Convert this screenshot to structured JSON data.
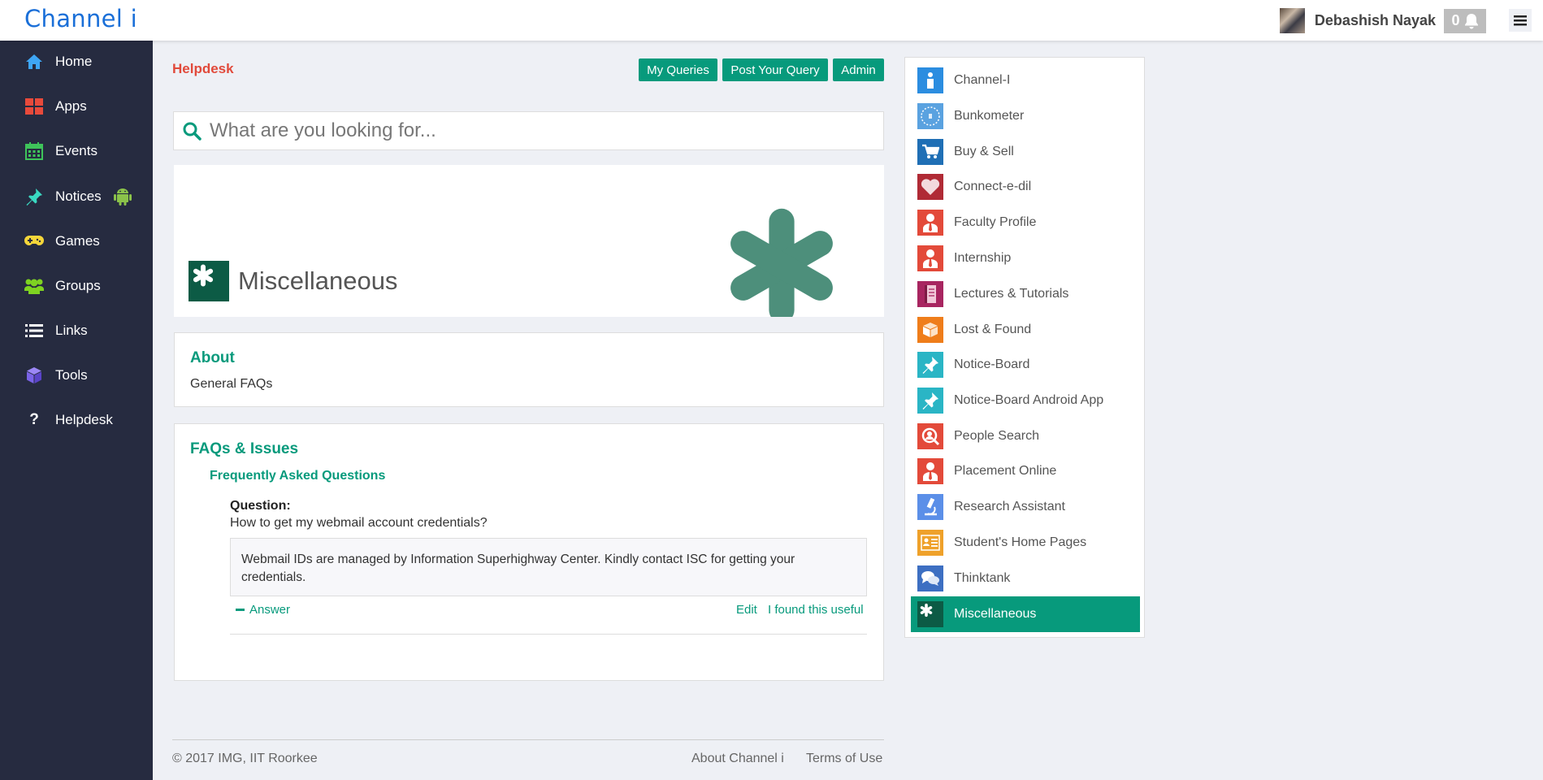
{
  "brand": "Channel i",
  "user": {
    "name": "Debashish Nayak",
    "notifications": "0"
  },
  "sidebar": {
    "items": [
      {
        "label": "Home",
        "icon": "home-icon",
        "color": "#3ea6f5"
      },
      {
        "label": "Apps",
        "icon": "apps-icon",
        "color": "#e84a3b"
      },
      {
        "label": "Events",
        "icon": "calendar-icon",
        "color": "#3ec35a"
      },
      {
        "label": "Notices",
        "icon": "pin-icon",
        "color": "#3ad9c2"
      },
      {
        "label": "Games",
        "icon": "gamepad-icon",
        "color": "#f5d63a"
      },
      {
        "label": "Groups",
        "icon": "users-icon",
        "color": "#7ed321"
      },
      {
        "label": "Links",
        "icon": "list-icon",
        "color": "#ffffff"
      },
      {
        "label": "Tools",
        "icon": "cube-icon",
        "color": "#7a63e8"
      },
      {
        "label": "Helpdesk",
        "icon": "question-icon",
        "color": "#ffffff"
      }
    ]
  },
  "main": {
    "title": "Helpdesk",
    "buttons": {
      "my_queries": "My Queries",
      "post_query": "Post Your Query",
      "admin": "Admin"
    },
    "search_placeholder": "What are you looking for...",
    "banner_title": "Miscellaneous",
    "about": {
      "heading": "About",
      "body": "General FAQs"
    },
    "faqs": {
      "heading": "FAQs & Issues",
      "subheading": "Frequently Asked Questions",
      "question_label": "Question:",
      "question": "How to get my webmail account credentials?",
      "answer": "Webmail IDs are managed by Information Superhighway Center. Kindly contact ISC for getting your credentials.",
      "answer_toggle": "Answer",
      "edit": "Edit",
      "useful": "I found this useful"
    }
  },
  "footer": {
    "copyright": "© 2017 IMG, IIT Roorkee",
    "about": "About Channel i",
    "terms": "Terms of Use"
  },
  "apps": [
    {
      "label": "Channel-I",
      "icon": "channel-i-icon",
      "color": "#2b8de0"
    },
    {
      "label": "Bunkometer",
      "icon": "clock-icon",
      "color": "#5aa2e0"
    },
    {
      "label": "Buy & Sell",
      "icon": "cart-icon",
      "color": "#1f6fb5"
    },
    {
      "label": "Connect-e-dil",
      "icon": "heart-icon",
      "color": "#b02a35"
    },
    {
      "label": "Faculty Profile",
      "icon": "person-tie-icon",
      "color": "#e34a3a"
    },
    {
      "label": "Internship",
      "icon": "person-tie-icon",
      "color": "#e34a3a"
    },
    {
      "label": "Lectures & Tutorials",
      "icon": "book-icon",
      "color": "#a82560"
    },
    {
      "label": "Lost & Found",
      "icon": "box-icon",
      "color": "#ef7d1a"
    },
    {
      "label": "Notice-Board",
      "icon": "pin-icon",
      "color": "#2ab5c5"
    },
    {
      "label": "Notice-Board Android App",
      "icon": "pin-icon",
      "color": "#2ab5c5"
    },
    {
      "label": "People Search",
      "icon": "person-search-icon",
      "color": "#e34a3a"
    },
    {
      "label": "Placement Online",
      "icon": "person-tie-icon",
      "color": "#e34a3a"
    },
    {
      "label": "Research Assistant",
      "icon": "microscope-icon",
      "color": "#5b8fe8"
    },
    {
      "label": "Student's Home Pages",
      "icon": "id-card-icon",
      "color": "#efa12a"
    },
    {
      "label": "Thinktank",
      "icon": "chat-icon",
      "color": "#3d6fc2"
    },
    {
      "label": "Miscellaneous",
      "icon": "asterisk-icon",
      "color": "#0c5b45",
      "active": true
    }
  ]
}
